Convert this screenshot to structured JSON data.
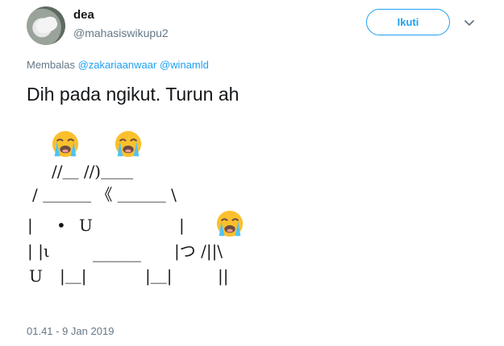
{
  "user": {
    "display_name": "dea",
    "username": "@mahasiswikupu2"
  },
  "follow_label": "Ikuti",
  "reply": {
    "prefix": "Membalas",
    "mentions": [
      "@zakariaanwaar",
      "@winamld"
    ]
  },
  "tweet": {
    "text": "Dih pada ngikut. Turun ah",
    "art": {
      "line1": "//＿ //)＿＿",
      "line2": "/ ＿＿＿ 《 ＿＿＿ \\",
      "line3a": "|",
      "line3b": "•",
      "line3c": "U",
      "line3d": "|",
      "line4a": "| |ι",
      "line4b": "＿＿＿",
      "line4c": "|つ /||\\",
      "line5a": "U",
      "line5b": "|＿|",
      "line5c": "|＿|",
      "line5d": "||"
    }
  },
  "icons": [
    "avatar",
    "chevron-down-icon",
    "loudly-crying-face-icon"
  ],
  "timestamp": "01.41 - 9 Jan 2019",
  "colors": {
    "accent": "#1da1f2",
    "secondary_text": "#657786",
    "emoji_face": "#fbc02d"
  }
}
